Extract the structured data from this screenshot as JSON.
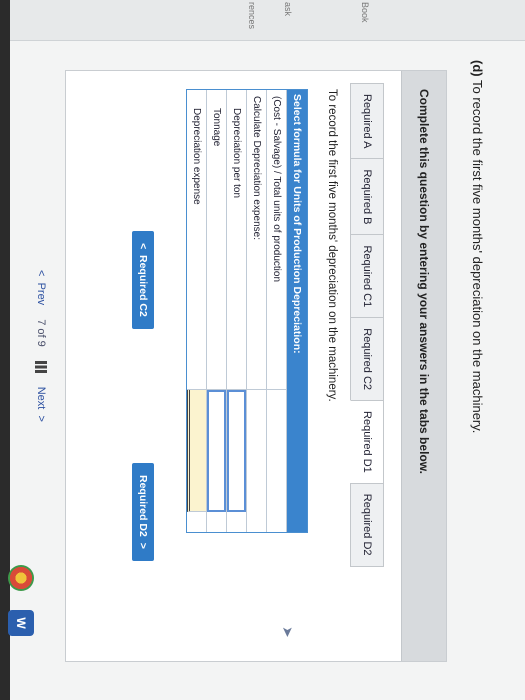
{
  "question": {
    "prefix": "(d)",
    "text": "To record the first five months' depreciation on the machinery."
  },
  "instruction": "Complete this question by entering your answers in the tabs below.",
  "left_strip": {
    "labels": [
      "Book",
      "ask",
      "rences"
    ]
  },
  "tabs": [
    {
      "label": "Required A",
      "active": false
    },
    {
      "label": "Required B",
      "active": false
    },
    {
      "label": "Required C1",
      "active": false
    },
    {
      "label": "Required C2",
      "active": false
    },
    {
      "label": "Required D1",
      "active": true
    },
    {
      "label": "Required D2",
      "active": false
    }
  ],
  "subtitle": "To record the first five months' depreciation on the machinery.",
  "formula_table": {
    "header": "Select formula for Units of Production Depreciation:",
    "formula": "(Cost - Salvage) / Total units of production",
    "calc_label": "Calculate Depreciation expense:",
    "rows": [
      {
        "label": "Depreciation per ton"
      },
      {
        "label": "Tonnage"
      },
      {
        "label": "Depreciation expense"
      }
    ]
  },
  "buttons": {
    "prev_tab": "Required C2",
    "next_tab": "Required D2",
    "prev_chevron": "<",
    "next_chevron": ">"
  },
  "footer": {
    "prev": "Prev",
    "page": "7 of 9",
    "next": "Next",
    "prev_chevron": "<",
    "next_chevron": ">"
  },
  "colors": {
    "accent": "#3a84cd",
    "button": "#2f7bc7",
    "highlight": "#fbf3cf"
  },
  "icons": [
    "grid-icon",
    "cursor-arrow-icon",
    "chrome-icon",
    "word-icon"
  ]
}
